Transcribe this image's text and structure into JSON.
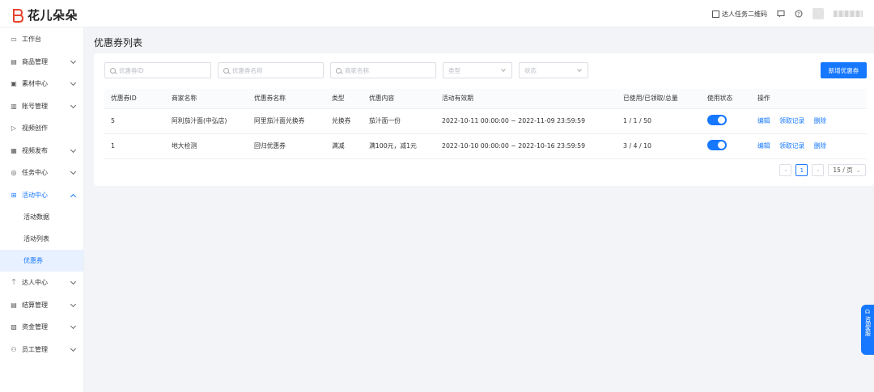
{
  "app": {
    "logo_text": "花儿朵朵"
  },
  "topbar": {
    "qr_label": "达人任务二维码"
  },
  "sidebar": {
    "items": [
      {
        "label": "工作台",
        "icon": "monitor-icon"
      },
      {
        "label": "商品管理",
        "icon": "bag-icon"
      },
      {
        "label": "素材中心",
        "icon": "image-icon"
      },
      {
        "label": "账号管理",
        "icon": "account-icon"
      },
      {
        "label": "视频创作",
        "icon": "video-icon"
      },
      {
        "label": "视频发布",
        "icon": "publish-icon"
      },
      {
        "label": "任务中心",
        "icon": "task-icon"
      },
      {
        "label": "活动中心",
        "icon": "activity-icon"
      },
      {
        "label": "达人中心",
        "icon": "talent-icon"
      },
      {
        "label": "结算管理",
        "icon": "settlement-icon"
      },
      {
        "label": "资金管理",
        "icon": "fund-icon"
      },
      {
        "label": "员工管理",
        "icon": "staff-icon"
      }
    ],
    "sub_items": [
      "活动数据",
      "活动列表",
      "优惠券"
    ]
  },
  "page": {
    "title": "优惠券列表"
  },
  "filters": {
    "coupon_id_placeholder": "优惠券ID",
    "coupon_name_placeholder": "优惠券名称",
    "merchant_name_placeholder": "商家名称",
    "type_placeholder": "类型",
    "status_placeholder": "状态",
    "new_button": "新增优惠券"
  },
  "table": {
    "headers": [
      "优惠券ID",
      "商家名称",
      "优惠券名称",
      "类型",
      "优惠内容",
      "活动有效期",
      "已使用/已领取/总量",
      "使用状态",
      "操作"
    ],
    "rows": [
      {
        "id": "5",
        "merchant": "阿利茄汁面(中弘店)",
        "name": "阿里茄汁面兑换券",
        "type": "兑换券",
        "content": "茄汁面一份",
        "period": "2022-10-11 00:00:00 ~ 2022-11-09 23:59:59",
        "usage": "1 / 1 / 50",
        "enabled": true
      },
      {
        "id": "1",
        "merchant": "地大检测",
        "name": "回归优惠券",
        "type": "满减",
        "content": "满100元，减1元",
        "period": "2022-10-10 00:00:00 ~ 2022-10-16 23:59:59",
        "usage": "3 / 4 / 10",
        "enabled": true
      }
    ],
    "actions": {
      "edit": "编辑",
      "records": "领取记录",
      "delete": "删除"
    }
  },
  "pagination": {
    "current_page": "1",
    "page_size": "15 / 页"
  },
  "float_help": {
    "label": "咨询客服"
  },
  "colors": {
    "primary": "#1677ff",
    "background": "#f3f4f7"
  }
}
